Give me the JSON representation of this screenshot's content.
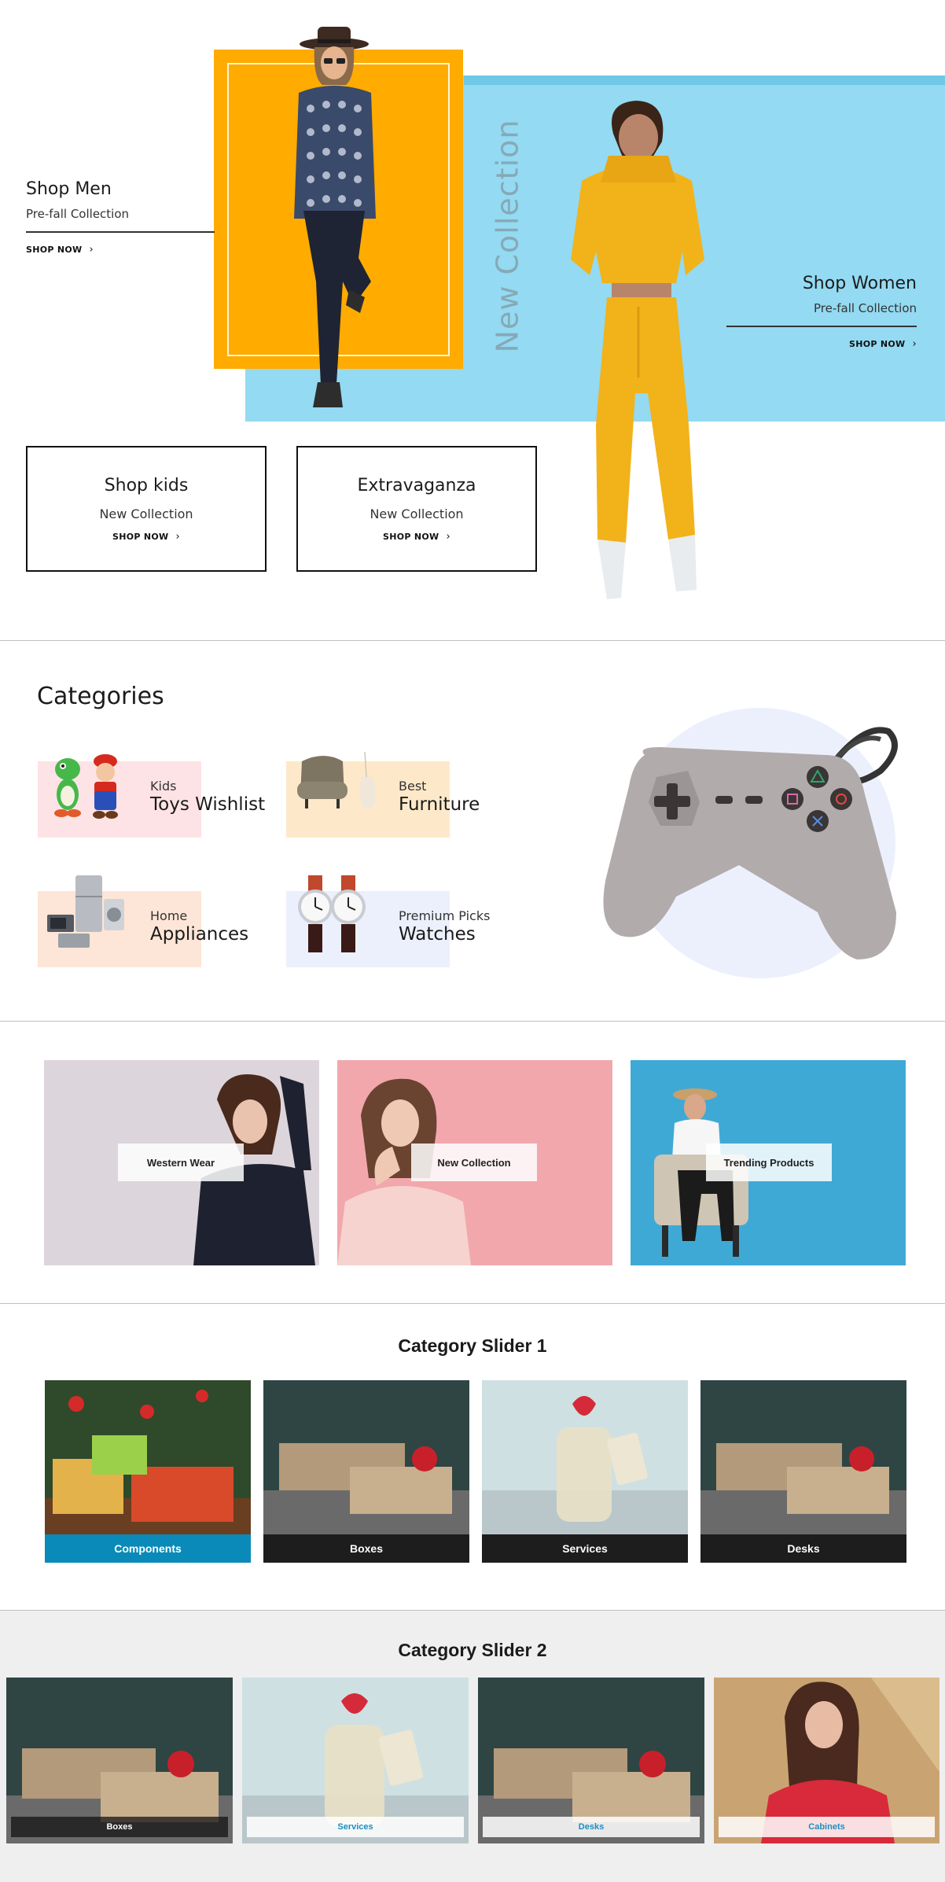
{
  "hero": {
    "vertical_text": "New Collection",
    "men": {
      "title": "Shop Men",
      "subtitle": "Pre-fall Collection",
      "link": "SHOP NOW"
    },
    "women": {
      "title": "Shop Women",
      "subtitle": "Pre-fall Collection",
      "link": "SHOP NOW"
    },
    "kids": {
      "title": "Shop kids",
      "subtitle": "New Collection",
      "link": "SHOP NOW"
    },
    "extravaganza": {
      "title": "Extravaganza",
      "subtitle": "New Collection",
      "link": "SHOP NOW"
    },
    "colors": {
      "orange": "#ffab00",
      "blue": "#93daf2"
    }
  },
  "categories": {
    "heading": "Categories",
    "items": [
      {
        "small": "Kids",
        "big": "Toys Wishlist",
        "bg": "#fde3e6",
        "icon": "toys-icon"
      },
      {
        "small": "Best",
        "big": "Furniture",
        "bg": "#fde9c9",
        "icon": "chair-icon"
      },
      {
        "small": "Home",
        "big": "Appliances",
        "bg": "#fde6d7",
        "icon": "appliances-icon"
      },
      {
        "small": "Premium Picks",
        "big": "Watches",
        "bg": "#ecf0fc",
        "icon": "watch-icon"
      }
    ],
    "feature_icon": "gamepad-icon"
  },
  "promos": [
    {
      "label": "Western Wear",
      "bg": "#ddd5dc"
    },
    {
      "label": "New Collection",
      "bg": "#f2a7ad"
    },
    {
      "label": "Trending Products",
      "bg": "#3fa9d6"
    }
  ],
  "slider1": {
    "title": "Category Slider 1",
    "items": [
      {
        "label": "Components",
        "active": true
      },
      {
        "label": "Boxes",
        "active": false
      },
      {
        "label": "Services",
        "active": false
      },
      {
        "label": "Desks",
        "active": false
      }
    ],
    "colors": {
      "active": "#0a8ab8",
      "inactive": "#1d1d1d"
    }
  },
  "slider2": {
    "title": "Category Slider 2",
    "items": [
      {
        "label": "Boxes"
      },
      {
        "label": "Services"
      },
      {
        "label": "Desks"
      },
      {
        "label": "Cabinets"
      }
    ]
  }
}
